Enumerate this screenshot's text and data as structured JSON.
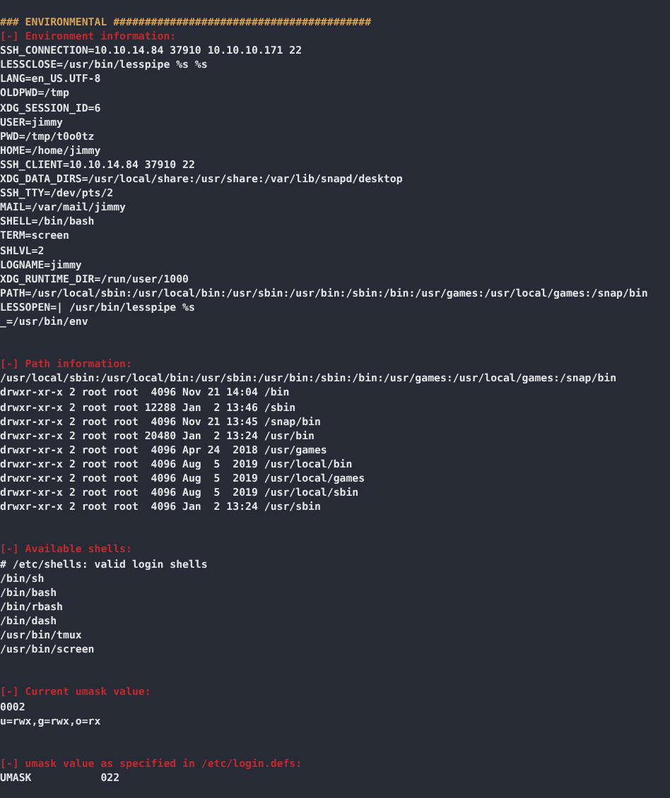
{
  "banner": "### ENVIRONMENTAL #########################################",
  "sections": [
    {
      "title": "[-] Environment information:",
      "lines": [
        "SSH_CONNECTION=10.10.14.84 37910 10.10.10.171 22",
        "LESSCLOSE=/usr/bin/lesspipe %s %s",
        "LANG=en_US.UTF-8",
        "OLDPWD=/tmp",
        "XDG_SESSION_ID=6",
        "USER=jimmy",
        "PWD=/tmp/t0o0tz",
        "HOME=/home/jimmy",
        "SSH_CLIENT=10.10.14.84 37910 22",
        "XDG_DATA_DIRS=/usr/local/share:/usr/share:/var/lib/snapd/desktop",
        "SSH_TTY=/dev/pts/2",
        "MAIL=/var/mail/jimmy",
        "SHELL=/bin/bash",
        "TERM=screen",
        "SHLVL=2",
        "LOGNAME=jimmy",
        "XDG_RUNTIME_DIR=/run/user/1000",
        "PATH=/usr/local/sbin:/usr/local/bin:/usr/sbin:/usr/bin:/sbin:/bin:/usr/games:/usr/local/games:/snap/bin",
        "LESSOPEN=| /usr/bin/lesspipe %s",
        "_=/usr/bin/env"
      ]
    },
    {
      "title": "[-] Path information:",
      "lines": [
        "/usr/local/sbin:/usr/local/bin:/usr/sbin:/usr/bin:/sbin:/bin:/usr/games:/usr/local/games:/snap/bin",
        "drwxr-xr-x 2 root root  4096 Nov 21 14:04 /bin",
        "drwxr-xr-x 2 root root 12288 Jan  2 13:46 /sbin",
        "drwxr-xr-x 2 root root  4096 Nov 21 13:45 /snap/bin",
        "drwxr-xr-x 2 root root 20480 Jan  2 13:24 /usr/bin",
        "drwxr-xr-x 2 root root  4096 Apr 24  2018 /usr/games",
        "drwxr-xr-x 2 root root  4096 Aug  5  2019 /usr/local/bin",
        "drwxr-xr-x 2 root root  4096 Aug  5  2019 /usr/local/games",
        "drwxr-xr-x 2 root root  4096 Aug  5  2019 /usr/local/sbin",
        "drwxr-xr-x 2 root root  4096 Jan  2 13:24 /usr/sbin"
      ]
    },
    {
      "title": "[-] Available shells:",
      "lines": [
        "# /etc/shells: valid login shells",
        "/bin/sh",
        "/bin/bash",
        "/bin/rbash",
        "/bin/dash",
        "/usr/bin/tmux",
        "/usr/bin/screen"
      ]
    },
    {
      "title": "[-] Current umask value:",
      "lines": [
        "0002",
        "u=rwx,g=rwx,o=rx"
      ]
    },
    {
      "title": "[-] umask value as specified in /etc/login.defs:",
      "lines": [
        "UMASK           022"
      ]
    }
  ]
}
